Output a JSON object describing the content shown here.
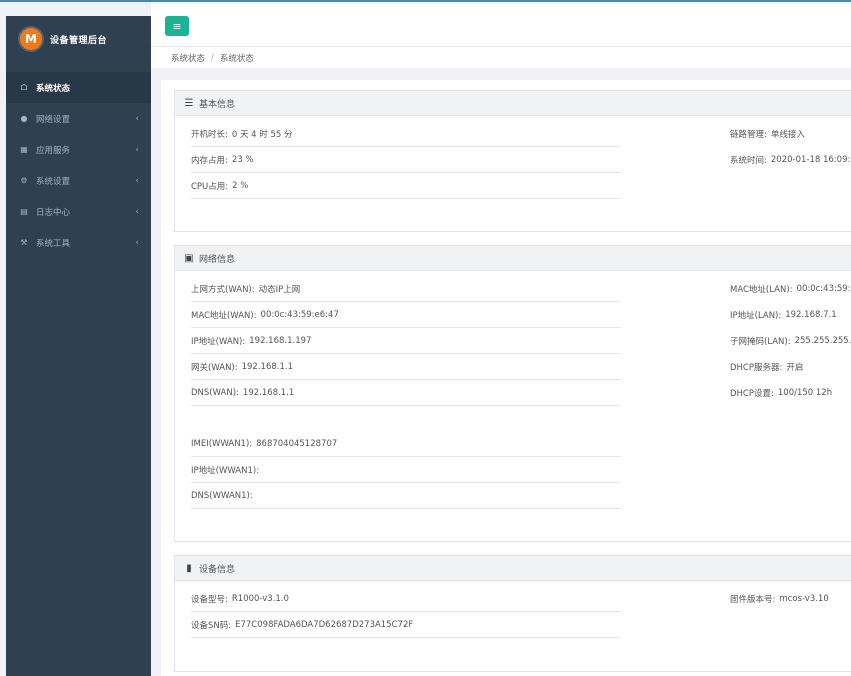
{
  "app": {
    "logo_letter": "M",
    "title": "设备管理后台"
  },
  "header": {
    "menu_glyph": "≡"
  },
  "breadcrumb": {
    "part1": "系统状态",
    "separator": "/",
    "part2": "系统状态"
  },
  "sidebar": {
    "items": [
      {
        "label": "系统状态",
        "icon": "home-icon"
      },
      {
        "label": "网络设置",
        "icon": "globe-icon"
      },
      {
        "label": "应用服务",
        "icon": "grid-icon"
      },
      {
        "label": "系统设置",
        "icon": "gear-icon"
      },
      {
        "label": "日志中心",
        "icon": "file-icon"
      },
      {
        "label": "系统工具",
        "icon": "wrench-icon"
      }
    ],
    "chevron": "‹"
  },
  "basic_info": {
    "title": "基本信息",
    "uptime_label": "开机时长:",
    "uptime_value": "0 天 4 时 55 分",
    "mem_label": "内存占用:",
    "mem_value": "23 %",
    "cpu_label": "CPU占用:",
    "cpu_value": "2 %",
    "link_label": "链路管理:",
    "link_value": "单线接入",
    "time_label": "系统时间:",
    "time_value": "2020-01-18 16:09:3"
  },
  "network_info": {
    "title": "网络信息",
    "wan_mode_label": "上网方式(WAN):",
    "wan_mode_value": "动态IP上网",
    "wan_mac_label": "MAC地址(WAN):",
    "wan_mac_value": "00:0c:43:59:e6:47",
    "wan_ip_label": "IP地址(WAN):",
    "wan_ip_value": "192.168.1.197",
    "wan_gw_label": "网关(WAN):",
    "wan_gw_value": "192.168.1.1",
    "wan_dns_label": "DNS(WAN):",
    "wan_dns_value": "192.168.1.1",
    "imei_label": "IMEI(WWAN1):",
    "imei_value": "868704045128707",
    "wwan_ip_label": "IP地址(WWAN1):",
    "wwan_dns_label": "DNS(WWAN1):",
    "lan_mac_label": "MAC地址(LAN):",
    "lan_mac_value": "00:0c:43:59:",
    "lan_ip_label": "IP地址(LAN):",
    "lan_ip_value": "192.168.7.1",
    "lan_mask_label": "子网掩码(LAN):",
    "lan_mask_value": "255.255.255.",
    "dhcp_server_label": "DHCP服务器:",
    "dhcp_server_value": "开启",
    "dhcp_setting_label": "DHCP设置:",
    "dhcp_setting_value": "100/150 12h"
  },
  "device_info": {
    "title": "设备信息",
    "model_label": "设备型号:",
    "model_value": "R1000-v3.1.0",
    "sn_label": "设备SN码:",
    "sn_value": "E77C098FADA6DA7D62687D273A15C72F",
    "fw_label": "固件版本号:",
    "fw_value": "mcos-v3.10"
  }
}
